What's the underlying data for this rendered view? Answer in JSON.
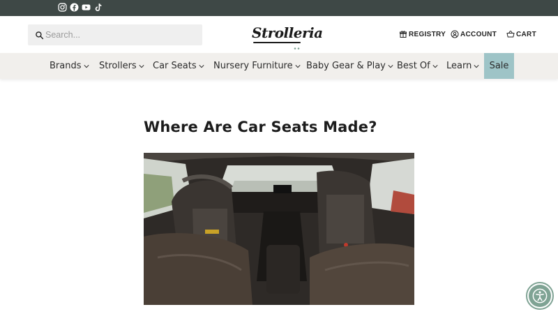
{
  "social": {
    "icons": [
      "instagram-icon",
      "facebook-icon",
      "youtube-icon",
      "tiktok-icon"
    ]
  },
  "header": {
    "search_placeholder": "Search...",
    "logo": "Strolleria",
    "registry_label": "REGISTRY",
    "account_label": "ACCOUNT",
    "cart_label": "CART"
  },
  "menu": {
    "items": [
      {
        "label": "Brands"
      },
      {
        "label": "Strollers"
      },
      {
        "label": "Car Seats"
      },
      {
        "label": "Nursery Furniture"
      },
      {
        "label": "Baby Gear & Play"
      },
      {
        "label": "Best Of"
      },
      {
        "label": "Learn"
      }
    ],
    "sale_label": "Sale"
  },
  "article": {
    "title": "Where Are Car Seats Made?"
  },
  "colors": {
    "topbar": "#3e4846",
    "menubar": "#f1efec",
    "sale_accent": "#9ec4c7",
    "a11y_accent": "#7fa394"
  }
}
